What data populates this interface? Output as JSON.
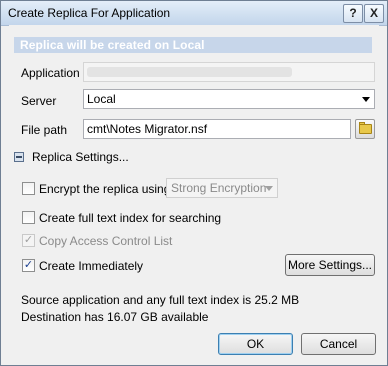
{
  "window": {
    "title": "Create Replica For Application",
    "help_glyph": "?",
    "close_glyph": "X"
  },
  "banner": "Replica will be created on Local",
  "form": {
    "application_label": "Application",
    "application_value": "",
    "server_label": "Server",
    "server_value": "Local",
    "filepath_label": "File path",
    "filepath_value": "cmt\\Notes Migrator.nsf"
  },
  "settings": {
    "section_label": "Replica Settings...",
    "encrypt_label": "Encrypt the replica using",
    "encrypt_checked": false,
    "encryption_value": "Strong Encryption",
    "fulltext_label": "Create full text index for searching",
    "fulltext_checked": false,
    "acl_label": "Copy Access Control List",
    "acl_checked": true,
    "acl_enabled": false,
    "immediate_label": "Create Immediately",
    "immediate_checked": true,
    "more_settings_label": "More Settings..."
  },
  "info": {
    "source_line": "Source application and any full text index is 25.2 MB",
    "destination_line": "Destination has 16.07 GB available"
  },
  "buttons": {
    "ok_label": "OK",
    "cancel_label": "Cancel"
  },
  "icons": {
    "help": "help-icon",
    "close": "close-icon",
    "browse": "folder-icon",
    "collapse": "collapse-icon",
    "dropdown": "chevron-down-icon"
  },
  "colors": {
    "banner_bg": "#c7d6ea",
    "banner_text": "#ffffff",
    "title_bar": "#cfdff0"
  }
}
